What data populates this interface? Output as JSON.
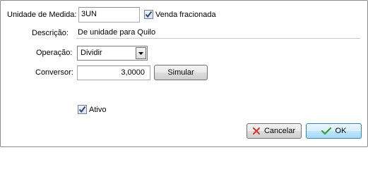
{
  "form": {
    "unidade_label": "Unidade de Medida:",
    "unidade_value": "3UN",
    "venda_fracionada_label": "Venda fracionada",
    "venda_fracionada_checked": true,
    "descricao_label": "Descrição:",
    "descricao_value": "De unidade para Quilo",
    "operacao_label": "Operação:",
    "operacao_value": "Dividir",
    "conversor_label": "Conversor:",
    "conversor_value": "3,0000",
    "simular_label": "Simular",
    "ativo_label": "Ativo",
    "ativo_checked": true
  },
  "footer": {
    "cancelar_label": "Cancelar",
    "ok_label": "OK"
  },
  "colors": {
    "check_mark": "#2a4a78",
    "cancel_icon": "#d9362b",
    "ok_icon": "#3d9b35",
    "focus_border": "#3c7fb1"
  },
  "icons": {
    "dropdown": "chevron-down-icon",
    "cancel": "close-icon",
    "ok": "checkmark-icon"
  }
}
